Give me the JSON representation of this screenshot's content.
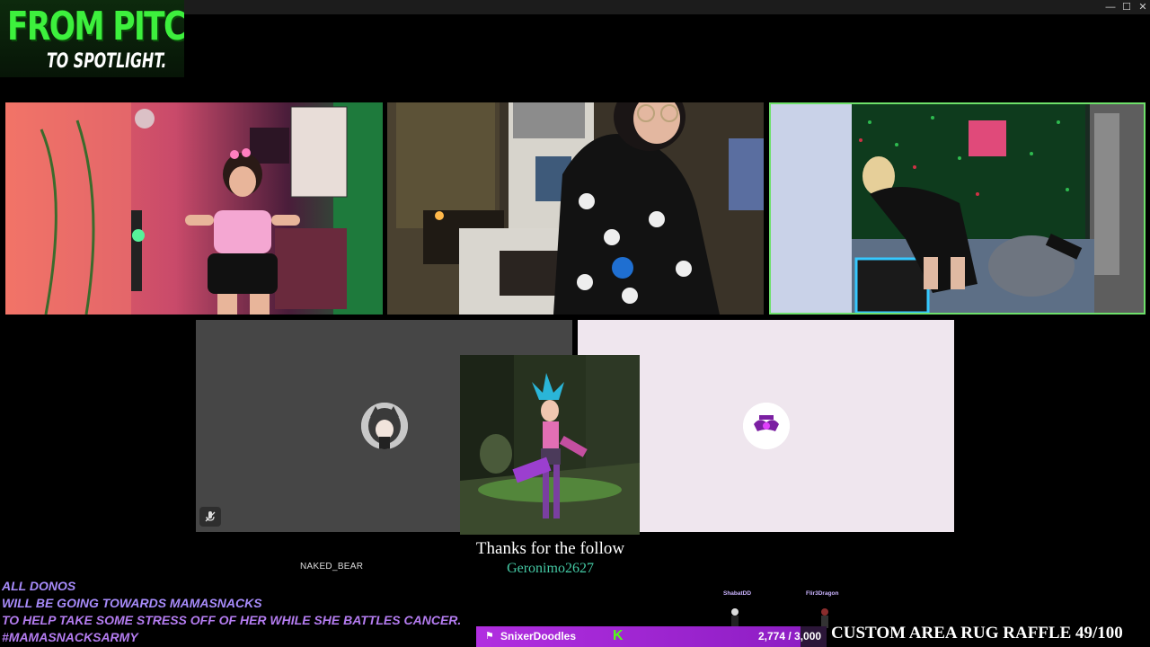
{
  "window": {
    "minimize": "—",
    "maximize": "☐",
    "close": "✕"
  },
  "logo": {
    "line1": "FROM PITCH",
    "line2": "TO SPOTLIGHT."
  },
  "streamers": [
    {
      "name": "cam-1"
    },
    {
      "name": "cam-2"
    },
    {
      "name": "cam-3",
      "active_speaker": true
    }
  ],
  "participants": [
    {
      "username": "NAKED_BEAR",
      "video": "off",
      "mic_muted": true,
      "tile_color": "#464646"
    },
    {
      "username": "",
      "video": "off",
      "tile_color": "#efe6ee"
    }
  ],
  "follow_alert": {
    "title": "Thanks for the follow",
    "follower": "Geronimo2627"
  },
  "donation_banner": {
    "lines": [
      "ALL DONOS",
      "WILL BE GOING TOWARDS MAMASNACKS",
      "TO HELP TAKE SOME STRESS OFF OF HER WHILE SHE BATTLES CANCER.",
      "#MAMASNACKSARMY"
    ]
  },
  "sub_goal": {
    "name": "SnixerDoodles",
    "platform_icon": "K",
    "count": "2,774 / 3,000",
    "progress": 0.925,
    "color": "#a62bd8"
  },
  "mini_avatars": [
    "ShabatDD",
    "Flir3Dragon"
  ],
  "raffle": {
    "text": "CUSTOM AREA RUG RAFFLE 49/100"
  },
  "colors": {
    "accent_green": "#53fc18",
    "active_border": "#6ee06a",
    "follower_name": "#44c9a4"
  }
}
